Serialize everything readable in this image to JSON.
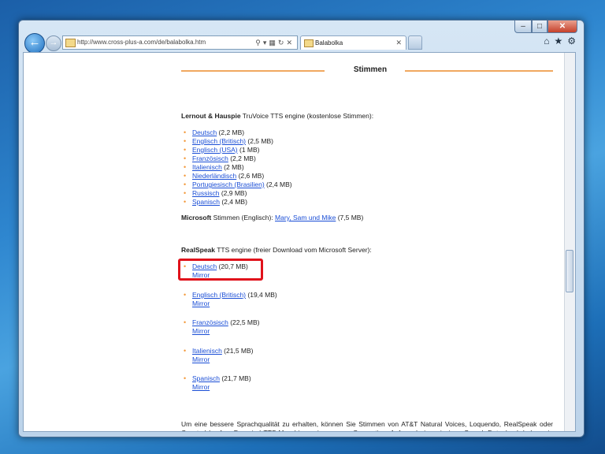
{
  "browser": {
    "url": "http://www.cross-plus-a.com/de/balabolka.htm",
    "tab_title": "Balabolka",
    "window_controls": {
      "minimize": "–",
      "maximize": "□",
      "close": "✕"
    }
  },
  "page": {
    "section_title": "Stimmen",
    "lh": {
      "brand": "Lernout & Hauspie",
      "rest": " TruVoice TTS engine (kostenlose Stimmen):",
      "items": [
        {
          "link": "Deutsch",
          "size": " (2,2 MB)"
        },
        {
          "link": "Englisch (Britisch)",
          "size": " (2,5 MB)"
        },
        {
          "link": "Englisch (USA)",
          "size": " (1 MB)"
        },
        {
          "link": "Französisch",
          "size": " (2,2 MB)"
        },
        {
          "link": "Italienisch",
          "size": " (2 MB)"
        },
        {
          "link": "Niederländisch",
          "size": " (2,6 MB)"
        },
        {
          "link": "Portugiesisch (Brasilien)",
          "size": " (2,4 MB)"
        },
        {
          "link": "Russisch",
          "size": " (2,9 MB)"
        },
        {
          "link": "Spanisch",
          "size": " (2,4 MB)"
        }
      ]
    },
    "ms": {
      "brand": "Microsoft",
      "rest": " Stimmen (Englisch): ",
      "link": "Mary, Sam und Mike",
      "size": " (7,5 MB)"
    },
    "rs": {
      "brand": "RealSpeak",
      "rest": " TTS engine (freier Download vom Microsoft Server):",
      "mirror_label": "Mirror",
      "items": [
        {
          "link": "Deutsch",
          "size": " (20,7 MB)"
        },
        {
          "link": "Englisch (Britisch)",
          "size": " (19,4 MB)"
        },
        {
          "link": "Französisch",
          "size": " (22,5 MB)"
        },
        {
          "link": "Italienisch",
          "size": " (21,5 MB)"
        },
        {
          "link": "Spanisch",
          "size": " (21,7 MB)"
        }
      ]
    },
    "paragraph": "Um eine bessere Sprachqualität zu erhalten, können Sie Stimmen von AT&T Natural Voices, Loquendo, RealSpeak oder Cepstral kaufen. Das sind TTS-Maschinen einer neuen Generation. Aufgrund einer riesigen Sprach-Datenbank haben sie eine ausgezeichnete Sprachausgabequalität."
  }
}
